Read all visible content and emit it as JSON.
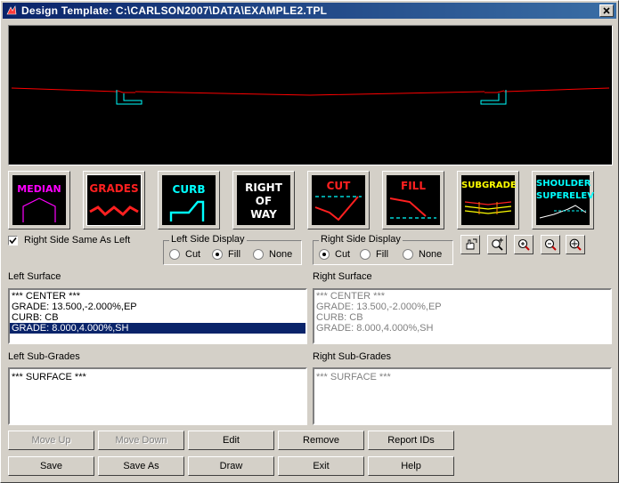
{
  "window": {
    "title": "Design Template: C:\\CARLSON2007\\DATA\\EXAMPLE2.TPL",
    "close_symbol": "×"
  },
  "template_buttons": [
    {
      "label": "MEDIAN",
      "icon": "median-icon",
      "color": "#ff00ff"
    },
    {
      "label": "GRADES",
      "icon": "grades-icon",
      "color": "#ff0000"
    },
    {
      "label": "CURB",
      "icon": "curb-icon",
      "color": "#00ffff"
    },
    {
      "label": "RIGHT OF WAY",
      "label_lines": [
        "RIGHT",
        "OF",
        "WAY"
      ],
      "icon": "right-of-way-icon",
      "color": "#ffffff"
    },
    {
      "label": "CUT",
      "icon": "cut-icon",
      "color": "#ff0000"
    },
    {
      "label": "FILL",
      "icon": "fill-icon",
      "color": "#ff0000"
    },
    {
      "label": "SUBGRADE",
      "icon": "subgrade-icon",
      "color": "#ffff00"
    },
    {
      "label": "SHOULDER SUPERELEV",
      "label_lines": [
        "SHOULDER",
        "SUPERELEV"
      ],
      "icon": "shoulder-superelev-icon",
      "color": "#00ffff"
    }
  ],
  "right_same_as_left": {
    "label": "Right Side Same As Left",
    "checked": true
  },
  "left_display": {
    "label": "Left Side Display",
    "options": [
      "Cut",
      "Fill",
      "None"
    ],
    "selected": "Fill"
  },
  "right_display": {
    "label": "Right Side Display",
    "options": [
      "Cut",
      "Fill",
      "None"
    ],
    "selected": "Cut"
  },
  "zoom_tools": [
    "pan-icon",
    "zoom-window-icon",
    "zoom-in-icon",
    "zoom-out-icon",
    "zoom-extents-icon"
  ],
  "left_surface": {
    "label": "Left Surface",
    "items": [
      "*** CENTER ***",
      "GRADE: 13.500,-2.000%,EP",
      "CURB: CB",
      "GRADE: 8.000,4.000%,SH"
    ],
    "selected_index": 3
  },
  "right_surface": {
    "label": "Right Surface",
    "items": [
      "*** CENTER ***",
      "GRADE: 13.500,-2.000%,EP",
      "CURB: CB",
      "GRADE: 8.000,4.000%,SH"
    ]
  },
  "left_subgrades": {
    "label": "Left Sub-Grades",
    "items": [
      "*** SURFACE ***"
    ]
  },
  "right_subgrades": {
    "label": "Right Sub-Grades",
    "items": [
      "*** SURFACE ***"
    ]
  },
  "buttons": {
    "move_up": "Move Up",
    "move_down": "Move Down",
    "edit": "Edit",
    "remove": "Remove",
    "report_ids": "Report IDs",
    "save": "Save",
    "save_as": "Save As",
    "draw": "Draw",
    "exit": "Exit",
    "help": "Help"
  },
  "colors": {
    "title_bar": "#0a246a",
    "selection": "#0a246a",
    "road_line": "#ff0000",
    "curb": "#00ffff"
  }
}
